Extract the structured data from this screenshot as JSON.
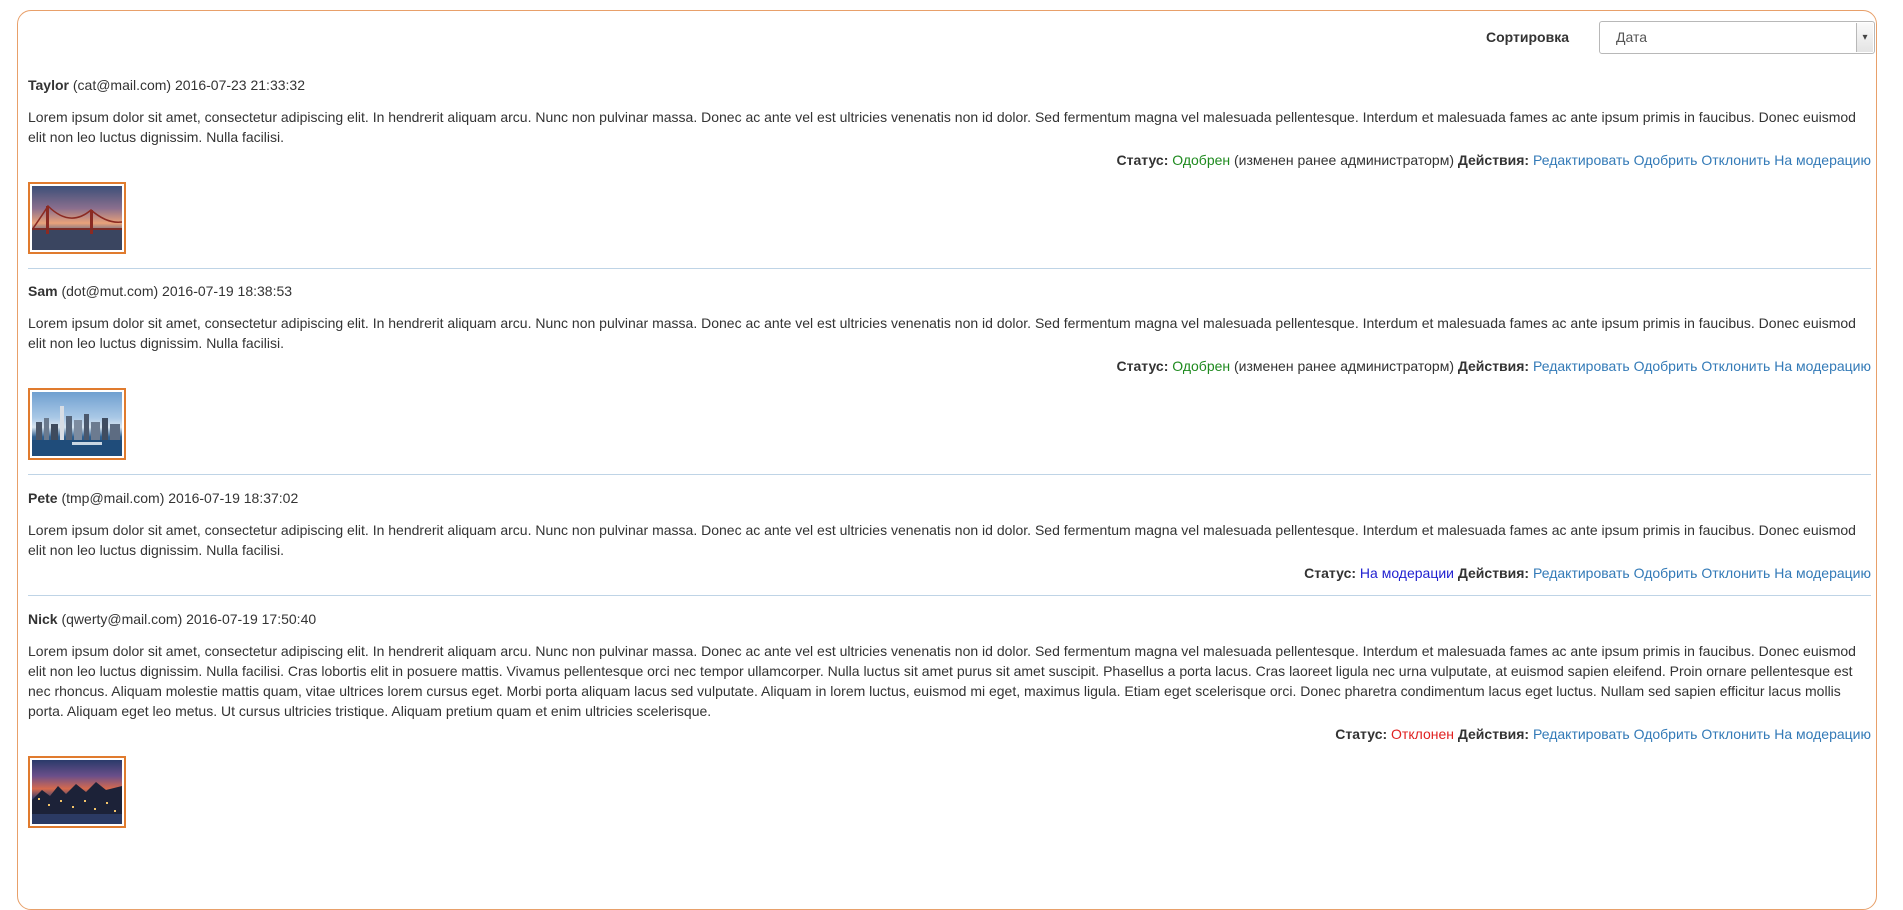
{
  "sort": {
    "label": "Сортировка",
    "selected": "Дата"
  },
  "labels": {
    "status": "Статус:",
    "actions": "Действия:"
  },
  "actions": [
    "Редактировать",
    "Одобрить",
    "Отклонить",
    "На модерацию"
  ],
  "reviews": [
    {
      "author": "Taylor",
      "email": "(cat@mail.com)",
      "datetime": "2016-07-23 21:33:32",
      "text": "Lorem ipsum dolor sit amet, consectetur adipiscing elit. In hendrerit aliquam arcu. Nunc non pulvinar massa. Donec ac ante vel est ultricies venenatis non id dolor. Sed fermentum magna vel malesuada pellentesque. Interdum et malesuada fames ac ante ipsum primis in faucibus. Donec euismod elit non leo luctus dignissim. Nulla facilisi.",
      "status": "Одобрен",
      "status_note": "(изменен ранее администраторм)",
      "status_color": "#1e8a1e",
      "image": "bridge-sunset-photo"
    },
    {
      "author": "Sam",
      "email": "(dot@mut.com)",
      "datetime": "2016-07-19 18:38:53",
      "text": "Lorem ipsum dolor sit amet, consectetur adipiscing elit. In hendrerit aliquam arcu. Nunc non pulvinar massa. Donec ac ante vel est ultricies venenatis non id dolor. Sed fermentum magna vel malesuada pellentesque. Interdum et malesuada fames ac ante ipsum primis in faucibus. Donec euismod elit non leo luctus dignissim. Nulla facilisi.",
      "status": "Одобрен",
      "status_note": "(изменен ранее администраторм)",
      "status_color": "#1e8a1e",
      "image": "city-skyline-photo"
    },
    {
      "author": "Pete",
      "email": "(tmp@mail.com)",
      "datetime": "2016-07-19 18:37:02",
      "text": "Lorem ipsum dolor sit amet, consectetur adipiscing elit. In hendrerit aliquam arcu. Nunc non pulvinar massa. Donec ac ante vel est ultricies venenatis non id dolor. Sed fermentum magna vel malesuada pellentesque. Interdum et malesuada fames ac ante ipsum primis in faucibus. Donec euismod elit non leo luctus dignissim. Nulla facilisi.",
      "status": "На модерации",
      "status_note": "",
      "status_color": "#1f1fd0",
      "image": ""
    },
    {
      "author": "Nick",
      "email": "(qwerty@mail.com)",
      "datetime": "2016-07-19 17:50:40",
      "text": "Lorem ipsum dolor sit amet, consectetur adipiscing elit. In hendrerit aliquam arcu. Nunc non pulvinar massa. Donec ac ante vel est ultricies venenatis non id dolor. Sed fermentum magna vel malesuada pellentesque. Interdum et malesuada fames ac ante ipsum primis in faucibus. Donec euismod elit non leo luctus dignissim. Nulla facilisi. Cras lobortis elit in posuere mattis. Vivamus pellentesque orci nec tempor ullamcorper. Nulla luctus sit amet purus sit amet suscipit. Phasellus a porta lacus. Cras laoreet ligula nec urna vulputate, at euismod sapien eleifend. Proin ornare pellentesque est nec rhoncus. Aliquam molestie mattis quam, vitae ultrices lorem cursus eget. Morbi porta aliquam lacus sed vulputate. Aliquam in lorem luctus, euismod mi eget, maximus ligula. Etiam eget scelerisque orci. Donec pharetra condimentum lacus eget luctus. Nullam sed sapien efficitur lacus mollis porta. Aliquam eget leo metus. Ut cursus ultricies tristique. Aliquam pretium quam et enim ultricies scelerisque.",
      "status": "Отклонен",
      "status_note": "",
      "status_color": "#e02020",
      "image": "harbor-night-photo"
    }
  ]
}
